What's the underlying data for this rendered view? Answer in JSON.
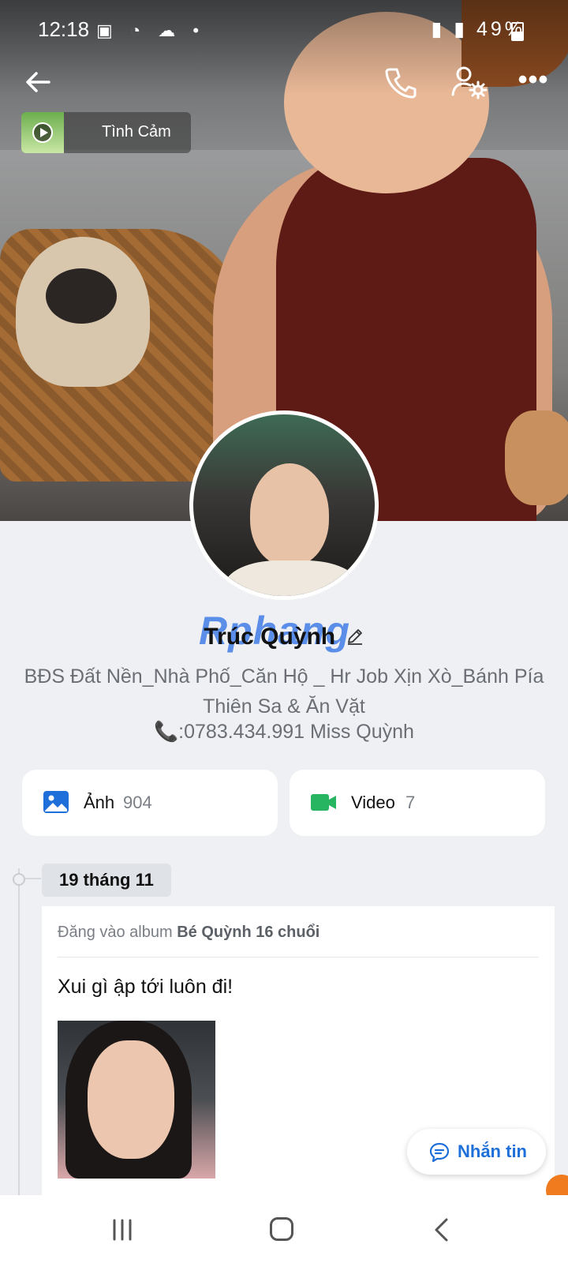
{
  "status_bar": {
    "time": "12:18",
    "battery": "49%"
  },
  "music": {
    "title": "Tình Cảm"
  },
  "profile": {
    "name": "Trúc Quỳnh",
    "watermark": "Rphang",
    "bio": "BĐS Đất Nền_Nhà Phố_Căn Hộ _ Hr Job Xịn Xò_Bánh Pía Thiên Sa & Ăn Vặt",
    "phone_line": "📞:0783.434.991 Miss Quỳnh"
  },
  "media": {
    "photos_label": "Ảnh",
    "photos_count": "904",
    "video_label": "Video",
    "video_count": "7"
  },
  "timeline": {
    "date": "19 tháng 11",
    "post": {
      "meta_prefix": "Đăng vào album ",
      "album": "Bé Quỳnh 16 chuổi",
      "text": "Xui gì ập tới luôn đi!"
    }
  },
  "actions": {
    "message_label": "Nhắn tin"
  },
  "colors": {
    "accent": "#1e6fd9",
    "photos_icon": "#1e6fd9",
    "video_icon": "#27b561",
    "background": "#eef0f3"
  },
  "icons": [
    "back-arrow-icon",
    "phone-icon",
    "user-settings-icon",
    "more-icon",
    "image-icon",
    "video-camera-icon",
    "chat-bubble-icon",
    "edit-pencil-icon"
  ]
}
